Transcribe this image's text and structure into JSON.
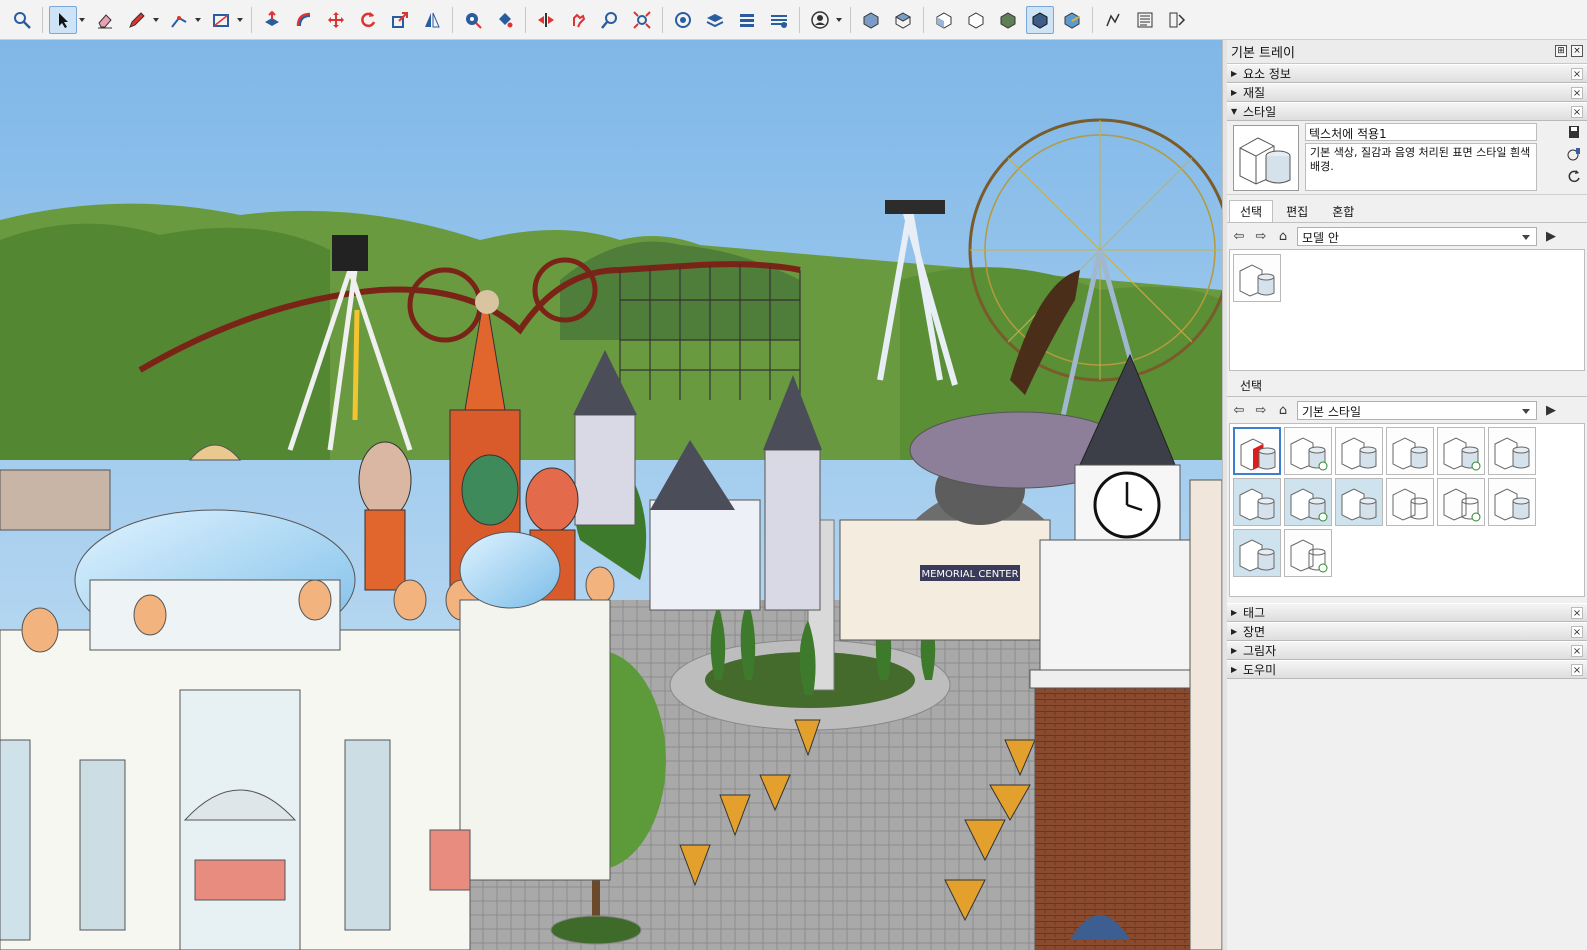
{
  "toolbar": {
    "icons": [
      "search-icon",
      "select-arrow-icon",
      "eraser-icon",
      "pencil-icon",
      "line-icon",
      "rectangle-icon",
      "push-pull-icon",
      "follow-me-icon",
      "move-icon",
      "rotate-icon",
      "scale-icon",
      "mirror-icon",
      "tape-measure-icon",
      "paint-bucket-icon",
      "section-plane-icon",
      "walk-icon",
      "zoom-icon",
      "zoom-extents-icon",
      "components-icon",
      "layers-icon",
      "scenes-icon",
      "materials-icon",
      "account-icon",
      "iso-view-icon",
      "top-view-icon",
      "front-view-icon",
      "right-view-icon",
      "back-view-icon",
      "left-view-icon",
      "bottom-view-icon",
      "solid-view-icon",
      "undo-sequence-icon",
      "outliner-icon",
      "entity-info-icon"
    ]
  },
  "tray": {
    "title": "기본 트레이",
    "panels_top": [
      {
        "label": "요소 정보",
        "expanded": false
      },
      {
        "label": "재질",
        "expanded": false
      },
      {
        "label": "스타일",
        "expanded": true
      }
    ],
    "style": {
      "name": "텍스처에 적용1",
      "description": "기본 색상, 질감과 음영 처리된 표면 스타일 흰색 배경."
    },
    "tabs": [
      "선택",
      "편집",
      "혼합"
    ],
    "active_tab": "선택",
    "in_model_select": "모델 안",
    "lower_tab": "선택",
    "library_select": "기본 스타일",
    "panels_bottom": [
      {
        "label": "태그",
        "expanded": false
      },
      {
        "label": "장면",
        "expanded": false
      },
      {
        "label": "그림자",
        "expanded": false
      },
      {
        "label": "도우미",
        "expanded": false
      }
    ]
  },
  "viewport": {
    "sign_text": "MEMORIAL CENTER"
  },
  "colors": {
    "sky": "#9cc9ee",
    "forest": "#5f8f3a",
    "selection_blue": "#3b7fd0",
    "coaster_red": "#7a2418"
  }
}
